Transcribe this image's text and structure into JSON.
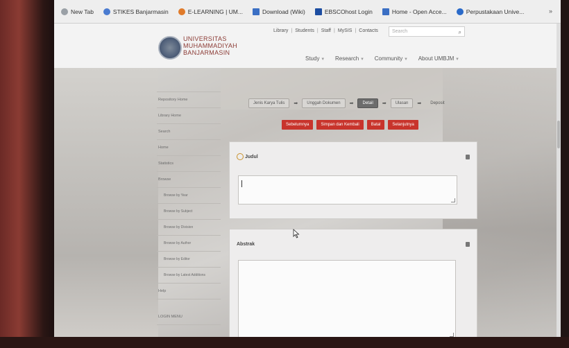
{
  "bookmarks": [
    {
      "label": "New Tab",
      "icon": "page-icon",
      "color": "#9aa0a6"
    },
    {
      "label": "STIKES Banjarmasin",
      "icon": "globe-icon",
      "color": "#4a7bd0"
    },
    {
      "label": "E-LEARNING | UM...",
      "icon": "moodle-icon",
      "color": "#e07b2a"
    },
    {
      "label": "Download (Wiki)",
      "icon": "doc-icon",
      "color": "#3b6fc4"
    },
    {
      "label": "EBSCOhost Login",
      "icon": "ebsco-icon",
      "color": "#1c4da1"
    },
    {
      "label": "Home - Open Acce...",
      "icon": "doc-icon",
      "color": "#3b6fc4"
    },
    {
      "label": "Perpustakaan Unive...",
      "icon": "globe-icon",
      "color": "#2a6ac9"
    }
  ],
  "header": {
    "logo_line1": "UNIVERSITAS",
    "logo_line2": "MUHAMMADIYAH",
    "logo_line3": "BANJARMASIN",
    "toplinks": [
      "Library",
      "Students",
      "Staff",
      "MySIS",
      "Contacts"
    ],
    "search_placeholder": "Search",
    "nav": [
      "Study",
      "Research",
      "Community",
      "About UMBJM"
    ]
  },
  "sidebar": {
    "items": [
      {
        "label": "Repository Home",
        "sub": false
      },
      {
        "label": "Library Home",
        "sub": false
      },
      {
        "label": "Search",
        "sub": false
      },
      {
        "label": "Home",
        "sub": false
      },
      {
        "label": "Statistics",
        "sub": false
      },
      {
        "label": "Browse",
        "sub": false
      },
      {
        "label": "Browse by Year",
        "sub": true
      },
      {
        "label": "Browse by Subject",
        "sub": true
      },
      {
        "label": "Browse by Division",
        "sub": true
      },
      {
        "label": "Browse by Author",
        "sub": true
      },
      {
        "label": "Browse by Editor",
        "sub": true
      },
      {
        "label": "Browse by Latest Additions",
        "sub": true
      },
      {
        "label": "Help",
        "sub": false
      },
      {
        "label": "LOGIN MENU",
        "sub": false
      }
    ]
  },
  "steps": {
    "items": [
      {
        "label": "Jenis Karya Tulis",
        "state": "done"
      },
      {
        "label": "Unggah Dokumen",
        "state": "done"
      },
      {
        "label": "Detail",
        "state": "active"
      },
      {
        "label": "Ulasan",
        "state": "todo"
      },
      {
        "label": "Deposit",
        "state": "plain"
      }
    ]
  },
  "actions": {
    "prev": "Sebelumnya",
    "save": "Simpan dan Kembali",
    "cancel": "Batal",
    "next": "Selanjutnya"
  },
  "panels": {
    "judul_label": "Judul",
    "judul_value": "",
    "abstrak_label": "Abstrak",
    "abstrak_value": ""
  },
  "colors": {
    "accent_red": "#c8342c",
    "logo_red": "#8b3a34"
  }
}
